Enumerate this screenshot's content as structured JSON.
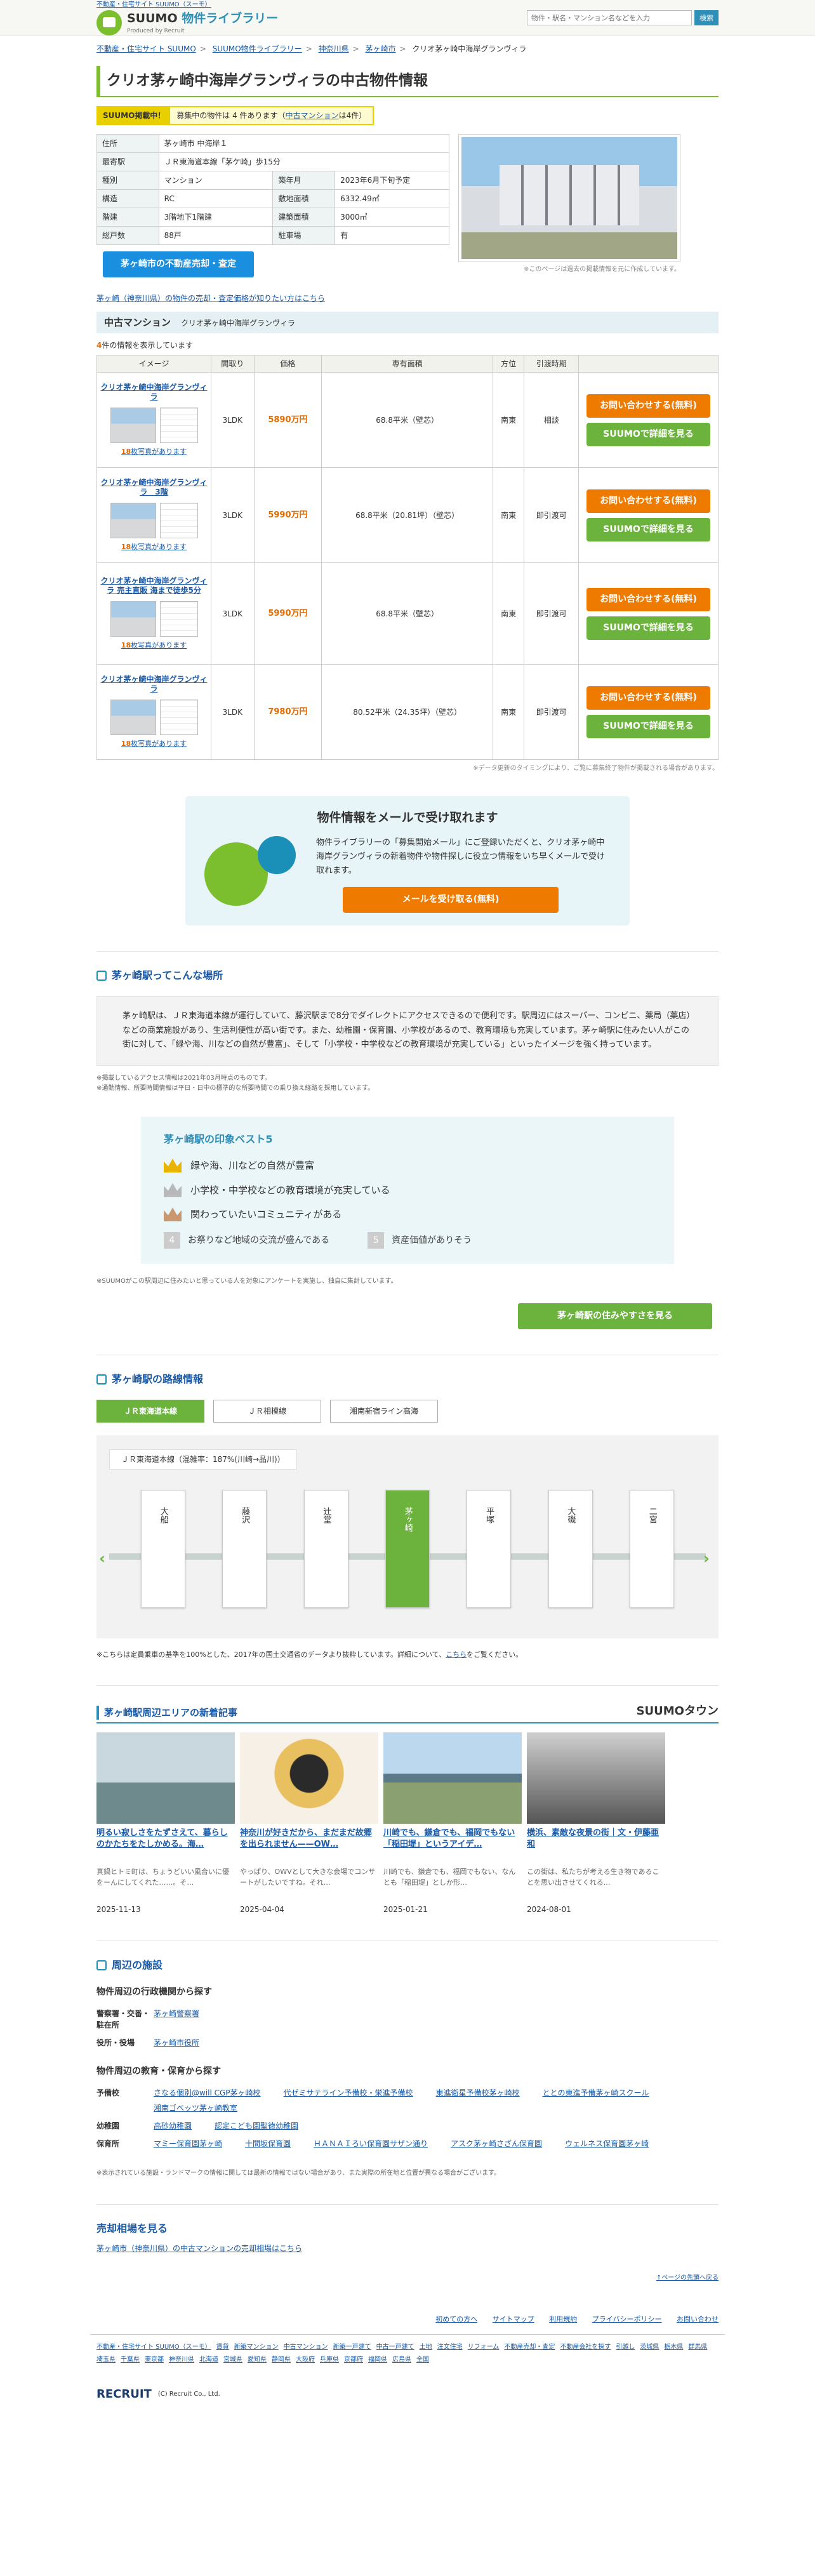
{
  "header": {
    "top_link": "不動産・住宅サイト SUUMO（スーモ）",
    "logo_main": "SUUMO",
    "logo_sub": "物件ライブラリー",
    "logo_by": "Produced by Recruit",
    "search_placeholder": "物件・駅名・マンション名などを入力",
    "search_button": "検索"
  },
  "breadcrumb": [
    "不動産・住宅サイト SUUMO",
    "SUUMO物件ライブラリー",
    "神奈川県",
    "茅ヶ崎市",
    "クリオ茅ヶ崎中海岸グランヴィラ"
  ],
  "page_title": "クリオ茅ヶ崎中海岸グランヴィラの中古物件情報",
  "notice": {
    "tag": "SUUMO掲載中！",
    "text": "募集中の物件は 4 件あります（",
    "link": "中古マンション",
    "tail": "は4件）"
  },
  "info": [
    [
      "住所",
      "茅ヶ崎市 中海岸１",
      "",
      ""
    ],
    [
      "最寄駅",
      "ＪＲ東海道本線「茅ケ崎」歩15分",
      "",
      ""
    ],
    [
      "種別",
      "マンション",
      "築年月",
      "2023年6月下旬予定"
    ],
    [
      "構造",
      "RC",
      "敷地面積",
      "6332.49㎡"
    ],
    [
      "階建",
      "3階地下1階建",
      "建築面積",
      "3000㎡"
    ],
    [
      "総戸数",
      "88戸",
      "駐車場",
      "有"
    ]
  ],
  "photo_note": "※このページは過去の掲載情報を元に作成しています。",
  "consult_button": "茅ヶ崎市の不動産売却・査定",
  "guide_link": "茅ヶ崎（神奈川県）の物件の売却・査定価格が知りたい方はこちら",
  "list_section": {
    "title": "中古マンション",
    "sub": "クリオ茅ヶ崎中海岸グランヴィラ",
    "count_pre": "4",
    "count_post": "件の情報を表示しています",
    "headers": [
      "イメージ",
      "間取り",
      "価格",
      "専有面積",
      "方位",
      "引渡時期",
      ""
    ],
    "rows": [
      {
        "name": "クリオ茅ヶ崎中海岸グランヴィラ",
        "photos": "18",
        "layout": "3LDK",
        "price": "5890万円",
        "area": "68.8平米（壁芯）",
        "dir": "南東",
        "delivery": "相談"
      },
      {
        "name": "クリオ茅ヶ崎中海岸グランヴィラ　3階",
        "photos": "18",
        "layout": "3LDK",
        "price": "5990万円",
        "area": "68.8平米（20.81坪）（壁芯）",
        "dir": "南東",
        "delivery": "即引渡可"
      },
      {
        "name": "クリオ茅ヶ崎中海岸グランヴィラ 売主直販 海まで徒歩5分",
        "photos": "18",
        "layout": "3LDK",
        "price": "5990万円",
        "area": "68.8平米（壁芯）",
        "dir": "南東",
        "delivery": "即引渡可"
      },
      {
        "name": "クリオ茅ヶ崎中海岸グランヴィラ",
        "photos": "18",
        "layout": "3LDK",
        "price": "7980万円",
        "area": "80.52平米（24.35坪）（壁芯）",
        "dir": "南東",
        "delivery": "即引渡可"
      }
    ],
    "inquiry": "お問い合わせする(無料)",
    "detail": "SUUMOで詳細を見る",
    "photo_suffix": "枚写真があります",
    "note": "※データ更新のタイミングにより、ご覧に募集終了物件が掲載される場合があります。"
  },
  "mail": {
    "title": "物件情報をメールで受け取れます",
    "desc": "物件ライブラリーの「募集開始メール」にご登録いただくと、クリオ茅ヶ崎中海岸グランヴィラの新着物件や物件探しに役立つ情報をいち早くメールで受け取れます。",
    "cta": "メールを受け取る(無料)"
  },
  "station": {
    "title": "茅ヶ崎駅ってこんな場所",
    "body": "茅ヶ崎駅は、ＪＲ東海道本線が運行していて、藤沢駅まで8分でダイレクトにアクセスできるので便利です。駅周辺にはスーパー、コンビニ、薬局（薬店）などの商業施設があり、生活利便性が高い街です。また、幼稚園・保育園、小学校があるので、教育環境も充実しています。茅ヶ崎駅に住みたい人がこの街に対して、「緑や海、川などの自然が豊富」、そして「小学校・中学校などの教育環境が充実している」といったイメージを強く持っています。",
    "notes": [
      "※掲載しているアクセス情報は2021年03月時点のものです。",
      "※通勤情報、所要時間情報は平日・日中の標準的な所要時間での乗り換え経路を採用しています。"
    ],
    "best_title": "茅ヶ崎駅の印象ベスト5",
    "best": [
      "緑や海、川などの自然が豊富",
      "小学校・中学校などの教育環境が充実している",
      "関わっていたいコミュニティがある",
      "お祭りなど地域の交流が盛んである",
      "資産価値がありそう"
    ],
    "best_note": "※SUUMOがこの駅周辺に住みたいと思っている人を対象にアンケートを実施し、独自に集計しています。",
    "more_button": "茅ヶ崎駅の住みやすさを見る"
  },
  "route": {
    "title": "茅ヶ崎駅の路線情報",
    "tabs": [
      "ＪＲ東海道本線",
      "ＪＲ相模線",
      "湘南新宿ライン高海"
    ],
    "label": "ＪＲ東海道本線（混雑率：187%(川崎→品川)）",
    "stations": [
      "大船",
      "藤沢",
      "辻堂",
      "茅ヶ崎",
      "平塚",
      "大磯",
      "二宮"
    ],
    "note_pre": "※こちらは定員乗車の基準を100%とした、2017年の国土交通省のデータより抜粋しています。詳細について、",
    "note_link": "こちら",
    "note_post": "をご覧ください。"
  },
  "news": {
    "title": "茅ヶ崎駅周辺エリアの新着記事",
    "brand": "SUUMOタウン",
    "items": [
      {
        "title": "明るい寂しさをたずさえて、暮らしのかたちをたしかめる。海…",
        "desc": "真鍋ヒトミ町は、ちょうどいい風合いに優をーんにしてくれた……。そ…",
        "date": "2025-11-13"
      },
      {
        "title": "神奈川が好きだから、まだまだ故郷を出られません——OW…",
        "desc": "やっぱり、OWVとして大きな会場でコンサートがしたいですね。それ…",
        "date": "2025-04-04"
      },
      {
        "title": "川崎でも、鎌倉でも、福岡でもない「稲田堤」というアイデ…",
        "desc": "川崎でも、鎌倉でも、福岡でもない、なんとも「稲田堤」としか形…",
        "date": "2025-01-21"
      },
      {
        "title": "横浜、素敵な夜景の街｜文・伊藤亜和",
        "desc": "この街は、私たちが考える生き物であることを思い出させてくれる…",
        "date": "2024-08-01"
      }
    ]
  },
  "facilities": {
    "title": "周辺の施設",
    "admin_title": "物件周辺の行政機関から探す",
    "admin": [
      [
        "警察署・交番・駐在所",
        "茅ヶ崎警察署"
      ],
      [
        "役所・役場",
        "茅ヶ崎市役所"
      ]
    ],
    "edu_title": "物件周辺の教育・保育から探す",
    "edu": [
      [
        "予備校",
        "さなる個別@will CGP茅ヶ崎校",
        "代ゼミサテライン予備校・栄進予備校",
        "東進衛星予備校茅ヶ崎校",
        "ととの東進予備茅ヶ崎スクール",
        "湘南ゴベッツ茅ヶ崎教室"
      ],
      [
        "幼稚園",
        "高砂幼稚園",
        "認定こども園聖徳幼稚園"
      ],
      [
        "保育所",
        "マミー保育園茅ヶ崎",
        "十間坂保育園",
        "ＨＡＮＡＩろい保育園サザン通り",
        "アスク茅ヶ崎さざん保育園",
        "ウェルネス保育園茅ヶ崎"
      ]
    ],
    "note": "※表示されている施設・ランドマークの情報に関しては最新の情報ではない場合があり、また実際の所在地と位置が異なる場合がございます。"
  },
  "market": {
    "title": "売却相場を見る",
    "link": "茅ヶ崎市（神奈川県）の中古マンションの売却相場はこちら",
    "top": "↑ページの先頭へ戻る"
  },
  "footer": {
    "links": [
      "初めての方へ",
      "サイトマップ",
      "利用規約",
      "プライバシーポリシー",
      "お問い合わせ"
    ],
    "sitemap": [
      "不動産・住宅サイト SUUMO（スーモ）",
      "賃貸",
      "新築マンション",
      "中古マンション",
      "新築一戸建て",
      "中古一戸建て",
      "土地",
      "注文住宅",
      "リフォーム",
      "不動産売却・査定",
      "不動産会社を探す",
      "引越し",
      "茨城県",
      "栃木県",
      "群馬県",
      "埼玉県",
      "千葉県",
      "東京都",
      "神奈川県",
      "北海道",
      "宮城県",
      "愛知県",
      "静岡県",
      "大阪府",
      "兵庫県",
      "京都府",
      "福岡県",
      "広島県",
      "全国"
    ],
    "company": "RECRUIT",
    "copy": "(C) Recruit Co., Ltd."
  }
}
